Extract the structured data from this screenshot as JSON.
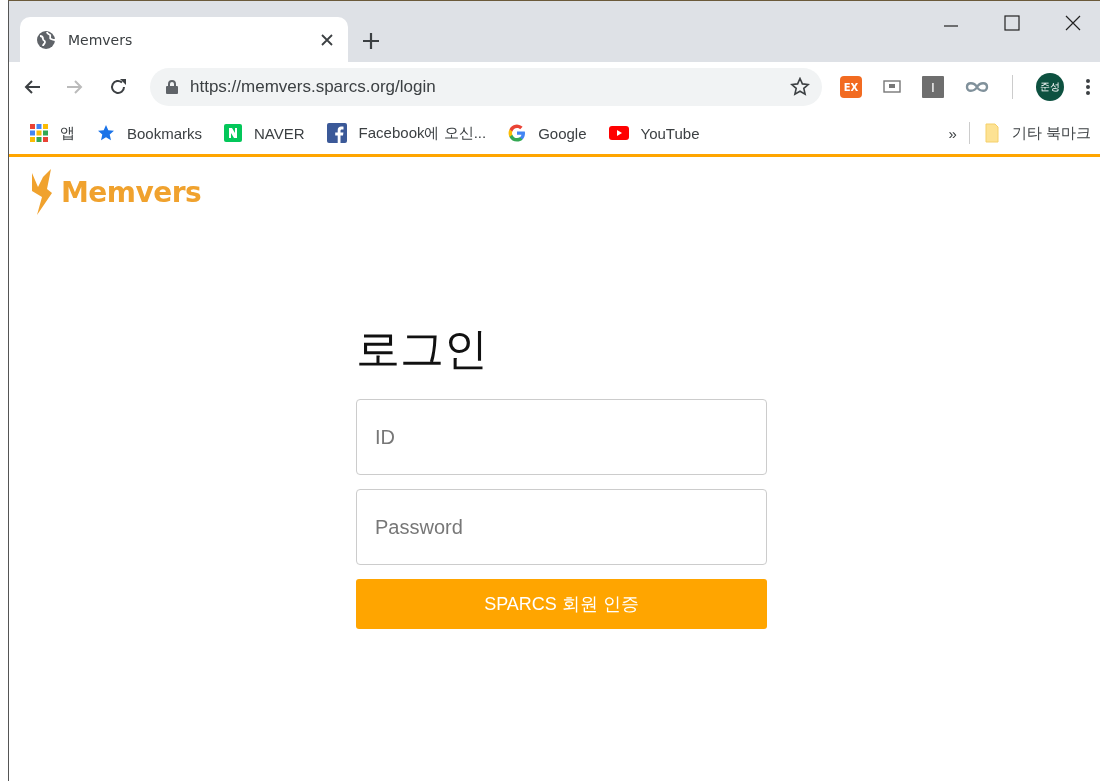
{
  "tabs": [
    {
      "title": "Memvers",
      "selected": true
    }
  ],
  "address_bar": {
    "url": "https://memvers.sparcs.org/login"
  },
  "extensions": [
    {
      "kind": "badge",
      "label": "EX"
    },
    {
      "kind": "screen"
    },
    {
      "kind": "badge-grey",
      "label": "I"
    },
    {
      "kind": "infinity"
    }
  ],
  "profile": {
    "initials": "준성"
  },
  "bookmarks": [
    {
      "kind": "apps",
      "label": "앱"
    },
    {
      "kind": "star",
      "label": "Bookmarks"
    },
    {
      "kind": "naver",
      "label": "NAVER"
    },
    {
      "kind": "facebook",
      "label": "Facebook에 오신..."
    },
    {
      "kind": "google",
      "label": "Google"
    },
    {
      "kind": "youtube",
      "label": "YouTube"
    }
  ],
  "bookmarks_overflow": "»",
  "other_bookmarks": "기타 북마크",
  "site": {
    "logo_text": "Memvers"
  },
  "login": {
    "heading": "로그인",
    "id_placeholder": "ID",
    "password_placeholder": "Password",
    "submit": "SPARCS 회원 인증"
  }
}
